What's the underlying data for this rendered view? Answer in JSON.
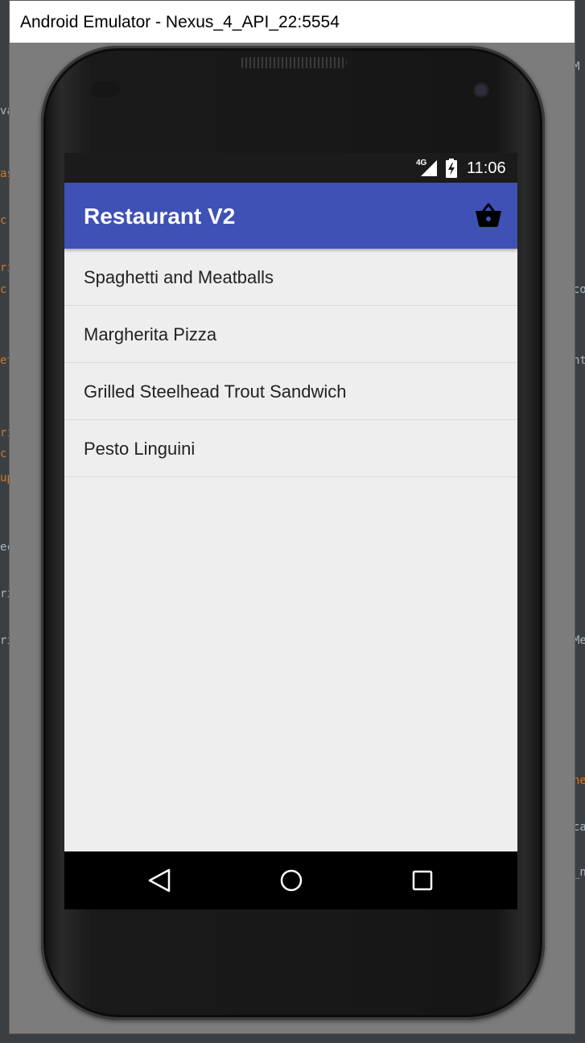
{
  "window": {
    "title": "Android Emulator - Nexus_4_API_22:5554"
  },
  "status_bar": {
    "network": "4G",
    "time": "11:06"
  },
  "app_bar": {
    "title": "Restaurant V2",
    "cart_icon": "basket-icon"
  },
  "menu": {
    "items": [
      {
        "label": "Spaghetti and Meatballs"
      },
      {
        "label": "Margherita Pizza"
      },
      {
        "label": "Grilled Steelhead Trout Sandwich"
      },
      {
        "label": "Pesto Linguini"
      }
    ]
  },
  "nav_bar": {
    "back_icon": "back-triangle-icon",
    "home_icon": "home-circle-icon",
    "recents_icon": "recents-square-icon"
  },
  "colors": {
    "app_bar": "#3f51b5",
    "status_bar": "#1b1b1b",
    "list_background": "#eeeeee",
    "nav_bar": "#000000"
  }
}
